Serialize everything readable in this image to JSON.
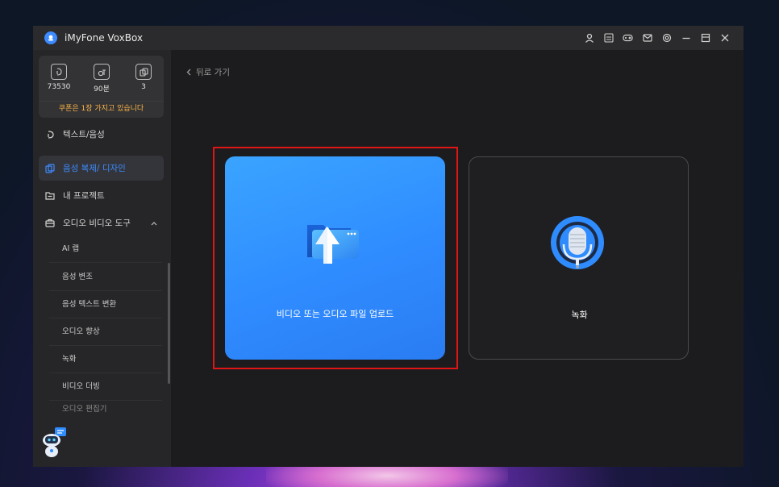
{
  "titlebar": {
    "app_title": "iMyFone VoxBox",
    "icons": [
      "user-icon",
      "app-icon",
      "gamepad-icon",
      "mail-icon",
      "settings-icon",
      "minimize-icon",
      "maximize-icon",
      "close-icon"
    ]
  },
  "stats": {
    "characters": "73530",
    "minutes": "90분",
    "count": "3",
    "coupon_text": "쿠폰은 1장 가지고 있습니다"
  },
  "sidebar": {
    "items": [
      {
        "label": "텍스트/음성",
        "icon": "text-speech-icon"
      },
      {
        "label": "음성 복제/ 디자인",
        "icon": "voice-clone-icon"
      },
      {
        "label": "내 프로젝트",
        "icon": "folder-icon"
      },
      {
        "label": "오디오 비디오 도구",
        "icon": "toolbox-icon"
      }
    ],
    "subitems": [
      "AI 랩",
      "음성 변조",
      "음성 텍스트 변환",
      "오디오 향상",
      "녹화",
      "비디오 더빙",
      "오디오 편집기"
    ]
  },
  "main": {
    "back_label": "뒤로 가기",
    "upload_label": "비디오 또는 오디오 파일 업로드",
    "record_label": "녹화"
  },
  "colors": {
    "accent": "#3d8bff",
    "coupon": "#ffb648",
    "highlight": "#e01515"
  }
}
